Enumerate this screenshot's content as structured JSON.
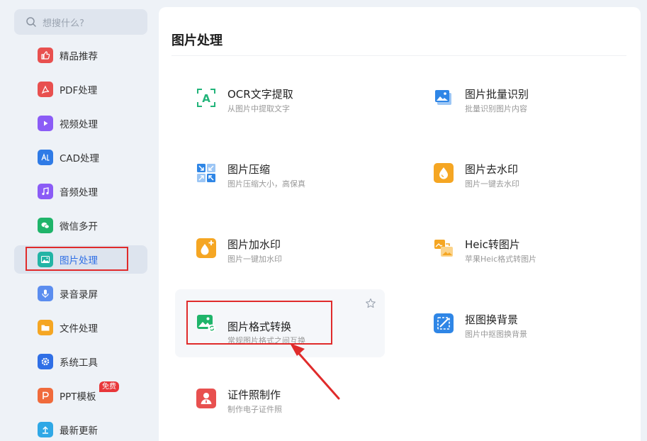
{
  "search": {
    "placeholder": "想搜什么?"
  },
  "sidebar": {
    "items": [
      {
        "label": "精品推荐",
        "icon": "thumbs-up-icon",
        "color": "#e8504f"
      },
      {
        "label": "PDF处理",
        "icon": "pdf-icon",
        "color": "#e8504f"
      },
      {
        "label": "视频处理",
        "icon": "play-icon",
        "color": "#8b5cf6"
      },
      {
        "label": "CAD处理",
        "icon": "cad-icon",
        "color": "#2f7be6"
      },
      {
        "label": "音频处理",
        "icon": "music-icon",
        "color": "#8b5cf6"
      },
      {
        "label": "微信多开",
        "icon": "wechat-icon",
        "color": "#1fb46a"
      },
      {
        "label": "图片处理",
        "icon": "image-icon",
        "color": "#22b4a5"
      },
      {
        "label": "录音录屏",
        "icon": "microphone-icon",
        "color": "#5b8def"
      },
      {
        "label": "文件处理",
        "icon": "folder-icon",
        "color": "#f5a623"
      },
      {
        "label": "系统工具",
        "icon": "gear-icon",
        "color": "#2f6fe6"
      },
      {
        "label": "PPT模板",
        "icon": "ppt-icon",
        "color": "#f06b3c",
        "badge": "免费"
      },
      {
        "label": "最新更新",
        "icon": "upload-icon",
        "color": "#2fa8e6"
      }
    ],
    "active": "图片处理"
  },
  "main": {
    "title": "图片处理",
    "tools": [
      {
        "name": "OCR文字提取",
        "desc": "从图片中提取文字",
        "icon": "ocr-icon",
        "color": "#22b47a"
      },
      {
        "name": "图片批量识别",
        "desc": "批量识别图片内容",
        "icon": "batch-image-icon",
        "color": "#2f86e6"
      },
      {
        "name": "图片压缩",
        "desc": "图片压缩大小，高保真",
        "icon": "compress-icon",
        "color": "#2f86e6"
      },
      {
        "name": "图片去水印",
        "desc": "图片一键去水印",
        "icon": "remove-watermark-icon",
        "color": "#f5a623"
      },
      {
        "name": "图片加水印",
        "desc": "图片一键加水印",
        "icon": "add-watermark-icon",
        "color": "#f5a623"
      },
      {
        "name": "Heic转图片",
        "desc": "苹果Heic格式转图片",
        "icon": "heic-convert-icon",
        "color": "#f5a623"
      },
      {
        "name": "图片格式转换",
        "desc": "常规图片格式之间互换",
        "icon": "format-convert-icon",
        "color": "#1fb46a"
      },
      {
        "name": "抠图换背景",
        "desc": "图片中抠图换背景",
        "icon": "cutout-icon",
        "color": "#2f86e6"
      },
      {
        "name": "证件照制作",
        "desc": "制作电子证件照",
        "icon": "id-photo-icon",
        "color": "#e8504f"
      }
    ]
  },
  "colors": {
    "highlight": "#e02b2b",
    "accent": "#2f6fe6"
  }
}
